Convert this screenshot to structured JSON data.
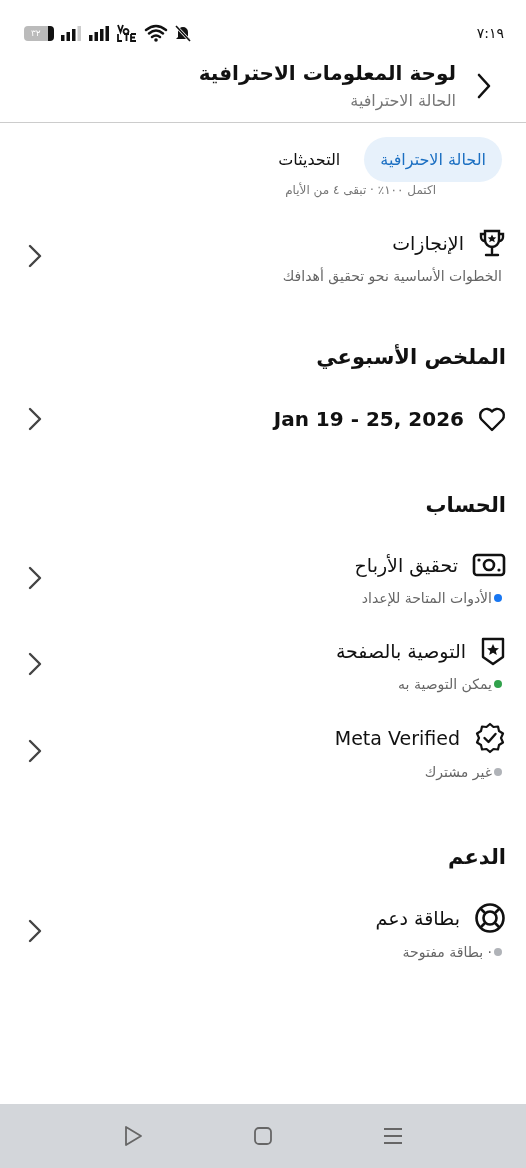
{
  "status_bar": {
    "time": "٧:١٩",
    "battery": "٣٢"
  },
  "header": {
    "title": "لوحة المعلومات الاحترافية",
    "subtitle": "الحالة الاحترافية"
  },
  "tabs": [
    {
      "label": "الحالة الاحترافية",
      "selected": true
    },
    {
      "label": "التحديثات",
      "selected": false
    }
  ],
  "progress_note": "اكتمل ١٠٠٪ · تبقى ٤ من الأيام",
  "achievements": {
    "title": "الإنجازات",
    "subtitle": "الخطوات الأساسية نحو تحقيق أهدافك"
  },
  "weekly_summary": {
    "heading": "الملخص الأسبوعي",
    "date_range": "Jan 19 - 25, 2026"
  },
  "account": {
    "heading": "الحساب",
    "items": [
      {
        "title": "تحقيق الأرباح",
        "status": "الأدوات المتاحة للإعداد",
        "color": "#1877f2"
      },
      {
        "title": "التوصية بالصفحة",
        "status": "يمكن التوصية به",
        "color": "#31a24c"
      },
      {
        "title": "Meta Verified",
        "status": "غير مشترك",
        "color": "#b0b3b8"
      }
    ]
  },
  "support": {
    "heading": "الدعم",
    "items": [
      {
        "title": "بطاقة دعم",
        "status": "· بطاقة مفتوحة",
        "color": "#b0b3b8"
      }
    ]
  }
}
